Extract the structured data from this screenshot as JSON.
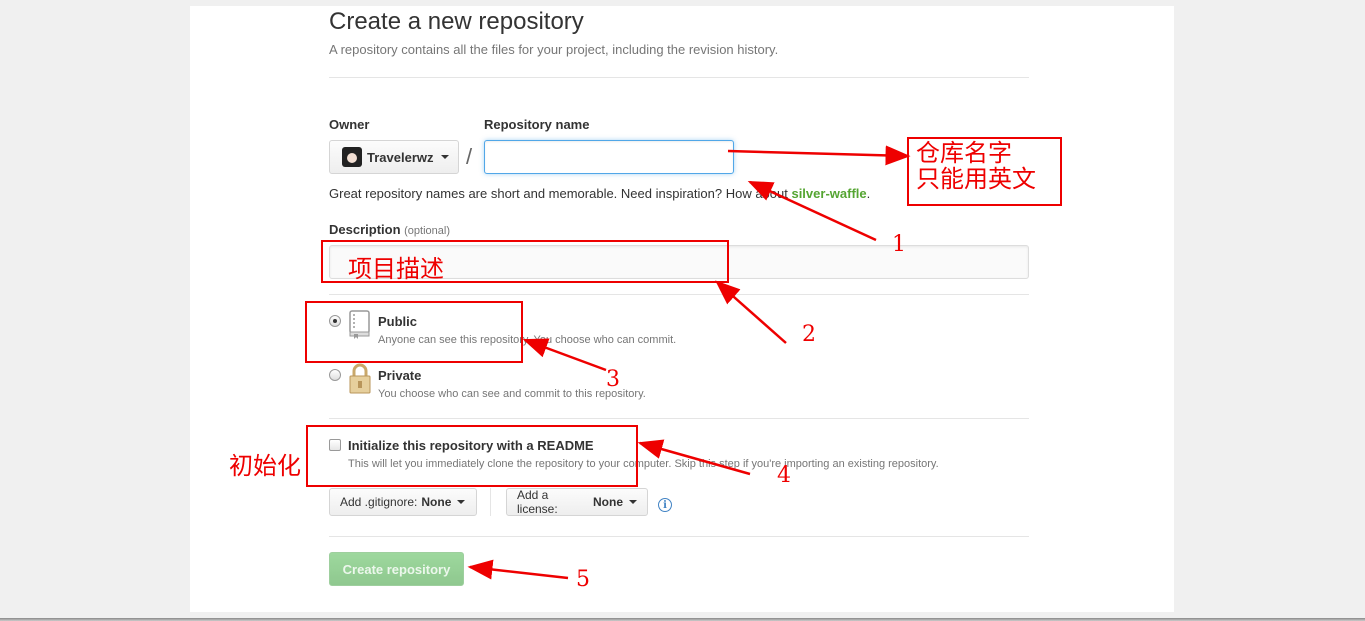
{
  "header": {
    "title": "Create a new repository",
    "subtitle": "A repository contains all the files for your project, including the revision history."
  },
  "owner": {
    "label": "Owner",
    "value": "Travelerwz"
  },
  "repo_name": {
    "label": "Repository name",
    "value": ""
  },
  "hint": {
    "prefix": "Great repository names are short and memorable. Need inspiration? How about ",
    "suggestion": "silver-waffle",
    "suffix": "."
  },
  "description": {
    "label": "Description",
    "optional": "(optional)",
    "value": ""
  },
  "visibility": {
    "public_title": "Public",
    "public_note": "Anyone can see this repository. You choose who can commit.",
    "private_title": "Private",
    "private_note": "You choose who can see and commit to this repository."
  },
  "init": {
    "title": "Initialize this repository with a README",
    "note": "This will let you immediately clone the repository to your computer. Skip this step if you're importing an existing repository."
  },
  "gitignore": {
    "label": "Add .gitignore:",
    "value": "None"
  },
  "license": {
    "label": "Add a license:",
    "value": "None"
  },
  "info_glyph": "i",
  "create_button": "Create repository",
  "annotations": {
    "repo_note_line1": "仓库名字",
    "repo_note_line2": "只能用英文",
    "desc_note": "项目描述",
    "init_note": "初始化",
    "n1": "1",
    "n2": "2",
    "n3": "3",
    "n4": "4",
    "n5": "5"
  },
  "colors": {
    "annotation": "#ee0000",
    "suggestion": "#55a532",
    "focus": "#51a7e8",
    "create_button": "#86cc86"
  }
}
